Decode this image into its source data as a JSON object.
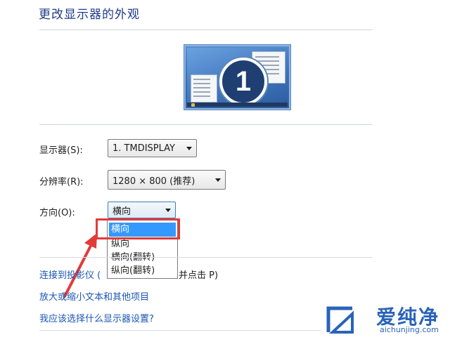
{
  "page": {
    "title": "更改显示器的外观"
  },
  "monitor_preview": {
    "number": "1"
  },
  "fields": {
    "display_label": "显示器(S):",
    "display_value": "1. TMDISPLAY",
    "resolution_label": "分辨率(R):",
    "resolution_value": "1280 × 800 (推荐)",
    "orientation_label": "方向(O):",
    "orientation_value": "横向"
  },
  "orientation_options": [
    {
      "label": "横向",
      "selected": true
    },
    {
      "label": "纵向",
      "selected": false
    },
    {
      "label": "横向(翻转)",
      "selected": false
    },
    {
      "label": "纵向(翻转)",
      "selected": false
    }
  ],
  "links": {
    "projector_prefix": "连接到投影仪 (",
    "projector_suffix": "并点击 P)",
    "text_size": "放大或缩小文本和其他项目",
    "which_settings": "我应该选择什么显示器设置?"
  },
  "watermark": {
    "cn": "爱纯净",
    "en": "aichunjing.com"
  },
  "colors": {
    "title": "#1e3a8a",
    "link": "#1a56b4",
    "highlight": "#3399ff",
    "annotation": "#e23a3a",
    "logo": "#2a63b8"
  }
}
